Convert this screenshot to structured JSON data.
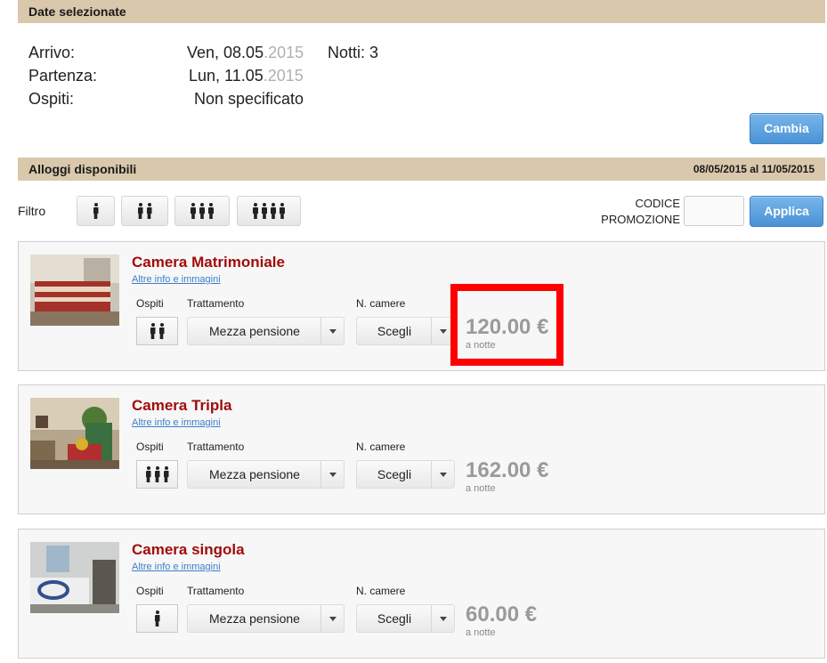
{
  "selected_dates": {
    "header": "Date selezionate",
    "arrival_label": "Arrivo:",
    "arrival_value": "Ven, 08.05",
    "arrival_year": ".2015",
    "nights": "Notti: 3",
    "departure_label": "Partenza:",
    "departure_value": "Lun, 11.05",
    "departure_year": ".2015",
    "guests_label": "Ospiti:",
    "guests_value": "Non specificato",
    "change_button": "Cambia"
  },
  "availability": {
    "header": "Alloggi disponibili",
    "range": "08/05/2015 al 11/05/2015",
    "filter_label": "Filtro",
    "filter_options": [
      1,
      2,
      3,
      4
    ],
    "promo_label_line1": "CODICE",
    "promo_label_line2": "PROMOZIONE",
    "promo_value": "",
    "apply_button": "Applica"
  },
  "rooms": [
    {
      "name": "Camera Matrimoniale",
      "more_link": "Altre info e immagini",
      "guests_header": "Ospiti",
      "occupancy": 2,
      "board_header": "Trattamento",
      "board_value": "Mezza pensione",
      "rooms_header": "N. camere",
      "rooms_value": "Scegli",
      "price": "120.00 €",
      "per_night": "a notte",
      "highlighted": true
    },
    {
      "name": "Camera Tripla",
      "more_link": "Altre info e immagini",
      "guests_header": "Ospiti",
      "occupancy": 3,
      "board_header": "Trattamento",
      "board_value": "Mezza pensione",
      "rooms_header": "N. camere",
      "rooms_value": "Scegli",
      "price": "162.00 €",
      "per_night": "a notte",
      "highlighted": false
    },
    {
      "name": "Camera singola",
      "more_link": "Altre info e immagini",
      "guests_header": "Ospiti",
      "occupancy": 1,
      "board_header": "Trattamento",
      "board_value": "Mezza pensione",
      "rooms_header": "N. camere",
      "rooms_value": "Scegli",
      "price": "60.00 €",
      "per_night": "a notte",
      "highlighted": false
    }
  ],
  "colors": {
    "bar": "#d9c8ac",
    "title": "#a10b0b",
    "link": "#3a7fc9",
    "button": "#4a92d6",
    "highlight": "#ff0000"
  },
  "icons": [
    "person-icon",
    "chevron-down-icon"
  ]
}
